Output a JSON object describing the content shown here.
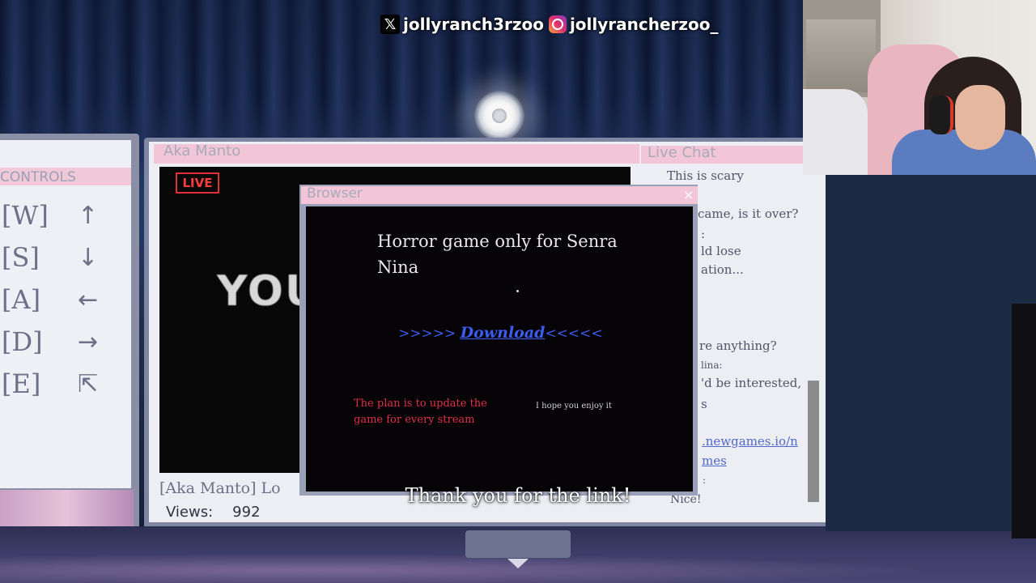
{
  "socials": {
    "x_handle": "jollyranch3rzoo",
    "instagram_handle": "jollyrancherzoo_"
  },
  "controls": {
    "title": "CONTROLS",
    "rows": [
      {
        "key": "[W]",
        "icon": "↑",
        "icon_name": "arrow-up-icon"
      },
      {
        "key": "[S]",
        "icon": "↓",
        "icon_name": "arrow-down-icon"
      },
      {
        "key": "[A]",
        "icon": "←",
        "icon_name": "arrow-left-icon"
      },
      {
        "key": "[D]",
        "icon": "→",
        "icon_name": "arrow-right-icon"
      },
      {
        "key": "[E]",
        "icon": "⇱",
        "icon_name": "cursor-click-icon"
      }
    ]
  },
  "stream": {
    "title": "Aka Manto",
    "live_label": "LIVE",
    "video_text": "YOU",
    "caption": "[Aka Manto] Lo",
    "views_label": "Views:",
    "views_value": "992"
  },
  "chat": {
    "title": "Live Chat",
    "lines": [
      "This is scary",
      "came, is it over?",
      ":",
      "ld lose",
      "ation...",
      "",
      "re anything?",
      "lina:",
      "'d be interested,",
      "s",
      ".newgames.io/n",
      "mes",
      ":",
      "Nice!"
    ]
  },
  "browser": {
    "title": "Browser",
    "close": "×",
    "headline": "Horror game only for Senra Nina",
    "download_prefix": ">>>>> ",
    "download_link": "Download",
    "download_suffix": "<<<<<",
    "plan": "The plan is to update the game for every stream",
    "enjoy": "I hope you enjoy it"
  },
  "subtitle": "Thank you for the link!",
  "colors": {
    "accent_pink": "#f2c6d6",
    "live_red": "#e03030",
    "link_blue": "#3c5cf0",
    "plan_red": "#e0304a"
  }
}
